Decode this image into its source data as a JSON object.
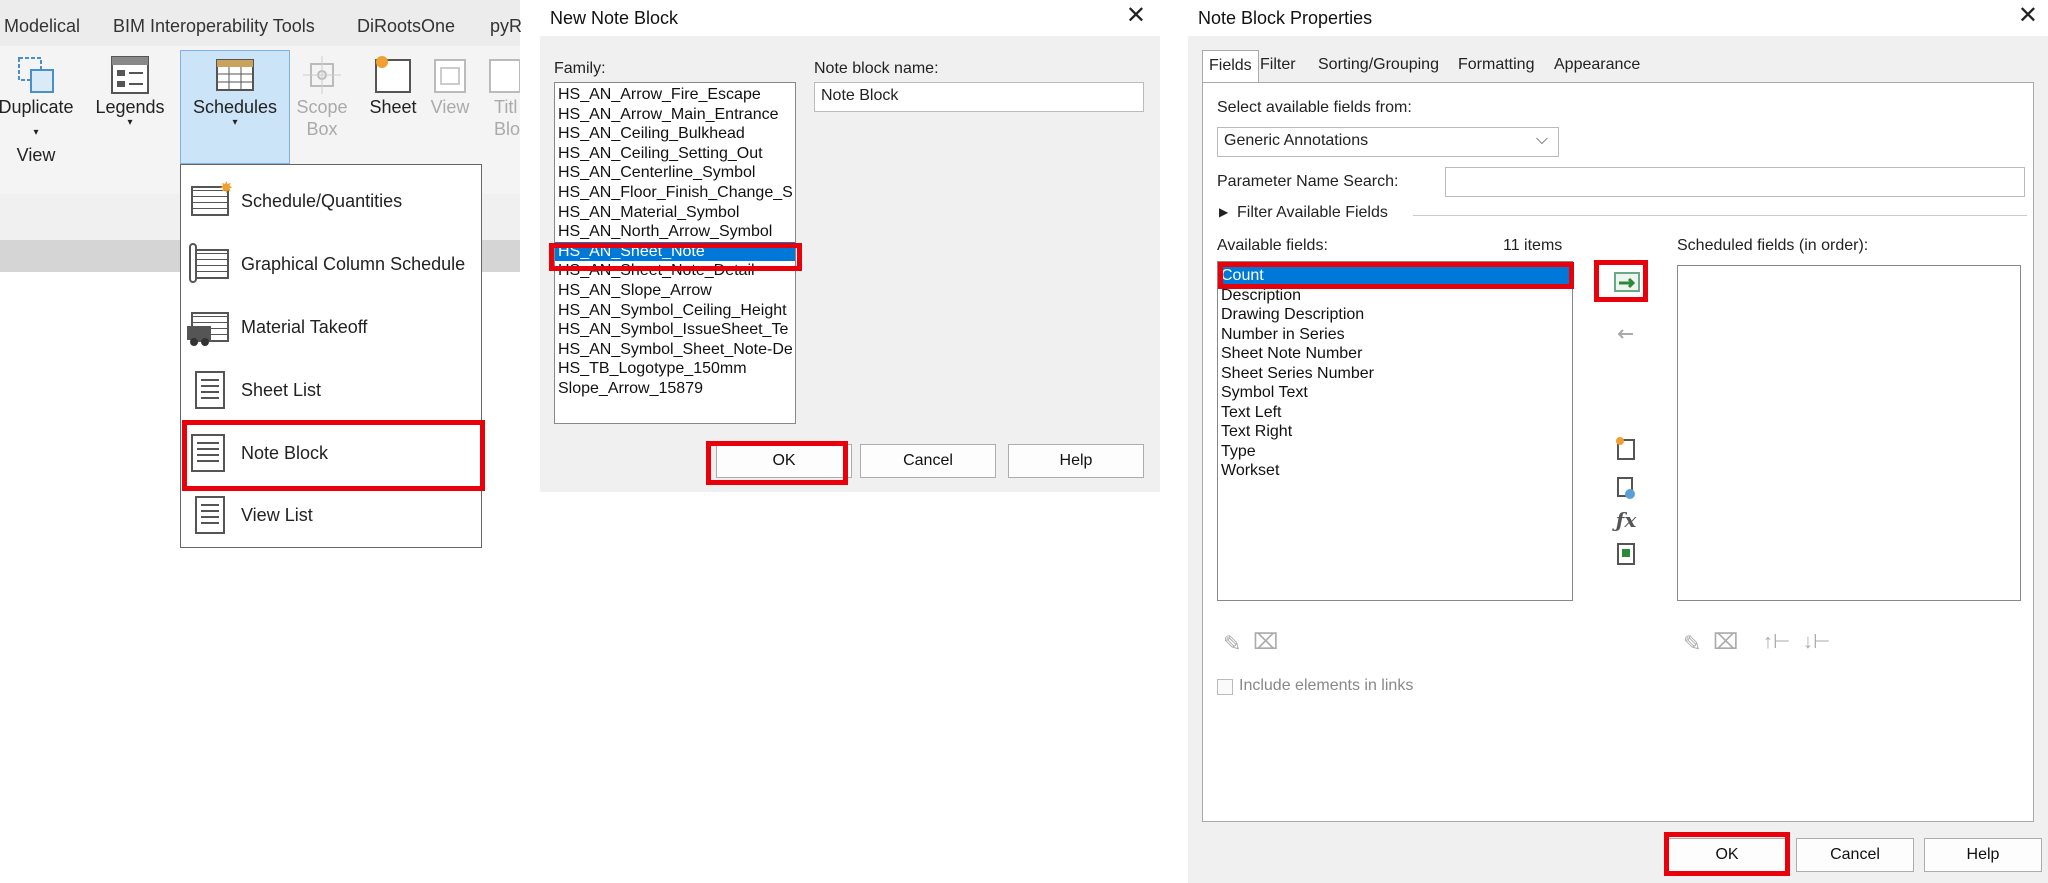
{
  "ribbon": {
    "tabs": [
      "Modelical",
      "BIM Interoperability Tools",
      "DiRootsOne",
      "pyR"
    ],
    "buttons": {
      "duplicate_view": [
        "Duplicate",
        "View"
      ],
      "legends": "Legends",
      "schedules": "Schedules",
      "scope_box": [
        "Scope",
        "Box"
      ],
      "sheet": "Sheet",
      "view": "View",
      "title_block": [
        "Titl",
        "Blo"
      ]
    },
    "dropdown_items": [
      "Schedule/Quantities",
      "Graphical Column Schedule",
      "Material Takeoff",
      "Sheet List",
      "Note Block",
      "View List"
    ]
  },
  "new_note_block": {
    "title": "New Note Block",
    "close": "✕",
    "family_label": "Family:",
    "families": [
      "HS_AN_Arrow_Fire_Escape",
      "HS_AN_Arrow_Main_Entrance",
      "HS_AN_Ceiling_Bulkhead",
      "HS_AN_Ceiling_Setting_Out",
      "HS_AN_Centerline_Symbol",
      "HS_AN_Floor_Finish_Change_S",
      "HS_AN_Material_Symbol",
      "HS_AN_North_Arrow_Symbol",
      "HS_AN_Sheet_Note",
      "HS_AN_Sheet_Note_Detail",
      "HS_AN_Slope_Arrow",
      "HS_AN_Symbol_Ceiling_Height",
      "HS_AN_Symbol_IssueSheet_Te",
      "HS_AN_Symbol_Sheet_Note-De",
      "HS_TB_Logotype_150mm",
      "Slope_Arrow_15879"
    ],
    "selected_family_index": 8,
    "name_label": "Note block name:",
    "name_value": "Note Block",
    "ok": "OK",
    "cancel": "Cancel",
    "help": "Help"
  },
  "note_block_properties": {
    "title": "Note Block Properties",
    "close": "✕",
    "tabs": [
      "Fields",
      "Filter",
      "Sorting/Grouping",
      "Formatting",
      "Appearance"
    ],
    "select_fields_label": "Select available fields from:",
    "select_fields_value": "Generic Annotations",
    "param_search_label": "Parameter Name Search:",
    "param_search_value": "",
    "filter_available_fields": "Filter Available Fields",
    "available_label": "Available fields:",
    "available_count": "11 items",
    "available_fields": [
      "Count",
      "Description",
      "Drawing Description",
      "Number in Series",
      "Sheet Note Number",
      "Sheet Series Number",
      "Symbol Text",
      "Text Left",
      "Text Right",
      "Type",
      "Workset"
    ],
    "selected_field_index": 0,
    "scheduled_label": "Scheduled fields (in order):",
    "include_links": "Include elements in links",
    "ok": "OK",
    "cancel": "Cancel",
    "help": "Help"
  },
  "icons": [
    "add-parameter-icon",
    "remove-parameter-icon",
    "new-parameter-icon",
    "combine-parameters-icon",
    "calculated-value-icon",
    "edit-icon",
    "delete-icon",
    "move-up-icon",
    "move-down-icon"
  ],
  "colors": {
    "selection": "#0078d7",
    "highlight_box": "#e8000b",
    "schedules_highlight": "#cce4f7"
  }
}
